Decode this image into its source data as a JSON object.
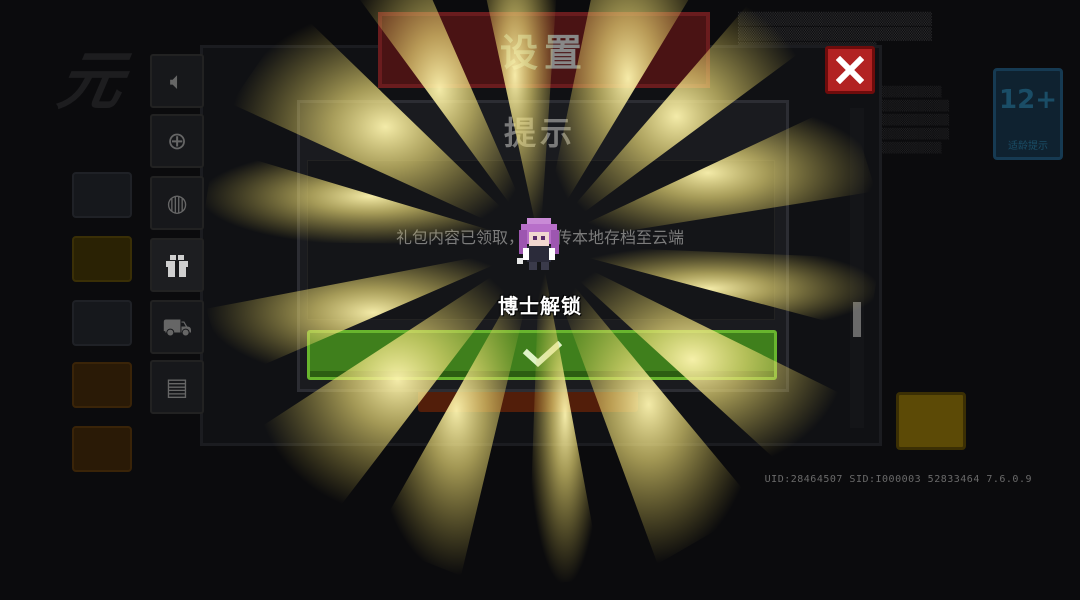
{
  "settings": {
    "title": "设置",
    "close_icon": "close-icon",
    "tabs": [
      {
        "icon": "volume-icon",
        "active": false
      },
      {
        "icon": "target-icon",
        "active": false
      },
      {
        "icon": "globe-icon",
        "active": false
      },
      {
        "icon": "gift-icon",
        "active": true
      },
      {
        "icon": "chest-icon",
        "active": false
      },
      {
        "icon": "file-icon",
        "active": false
      }
    ]
  },
  "hint_dialog": {
    "title": "提示",
    "message": "礼包内容已领取，请上传本地存档至云端",
    "confirm_icon": "checkmark-icon"
  },
  "reward": {
    "label": "博士解锁",
    "character_icon": "doctor-character-icon"
  },
  "background": {
    "age_rating": "12+",
    "age_sub": "适龄提示"
  },
  "footer": {
    "uid_text": "UID:28464507 SID:I000003 52833464 7.6.0.9"
  },
  "colors": {
    "confirm_green": "#3f7f1c",
    "close_red": "#b22222",
    "ray_yellow": "#f3e27a",
    "settings_header_red": "#6a1c1e"
  }
}
